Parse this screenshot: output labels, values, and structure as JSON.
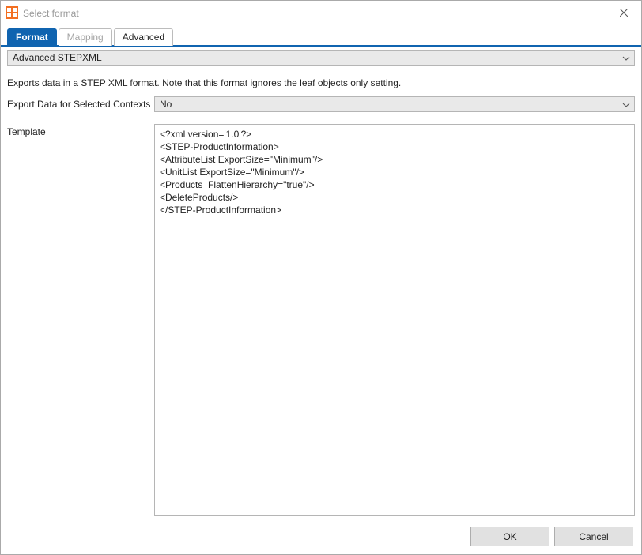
{
  "window": {
    "title": "Select format"
  },
  "tabs": {
    "format": "Format",
    "mapping": "Mapping",
    "advanced": "Advanced"
  },
  "format_dropdown": {
    "value": "Advanced STEPXML"
  },
  "description": "Exports data in a STEP XML format. Note that this format ignores the leaf objects only setting.",
  "fields": {
    "contexts_label": "Export Data for Selected Contexts",
    "contexts_value": "No",
    "template_label": "Template",
    "template_value": "<?xml version='1.0'?>\n<STEP-ProductInformation>\n<AttributeList ExportSize=\"Minimum\"/>\n<UnitList ExportSize=\"Minimum\"/>\n<Products  FlattenHierarchy=\"true\"/>\n<DeleteProducts/>\n</STEP-ProductInformation>"
  },
  "buttons": {
    "ok": "OK",
    "cancel": "Cancel"
  }
}
